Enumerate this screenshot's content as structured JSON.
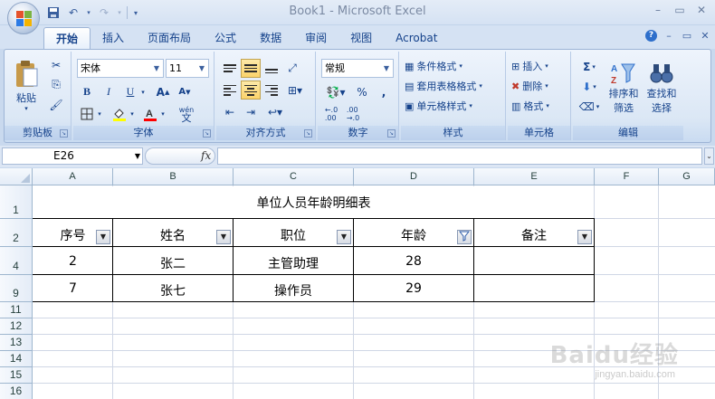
{
  "window": {
    "title": "Book1 - Microsoft Excel",
    "controls": [
      "–",
      "▭",
      "✕"
    ]
  },
  "qat": {
    "save_icon": "save-icon",
    "undo_icon": "undo-icon",
    "redo_icon": "redo-icon"
  },
  "ribbon_tabs": [
    "开始",
    "插入",
    "页面布局",
    "公式",
    "数据",
    "审阅",
    "视图",
    "Acrobat"
  ],
  "ribbon_tab_active": "开始",
  "ribbon_right": [
    "?",
    "–",
    "▭",
    "✕"
  ],
  "clipboard": {
    "paste_label": "粘贴",
    "group_label": "剪贴板"
  },
  "font": {
    "name": "宋体",
    "size": "11",
    "bold": "B",
    "italic": "I",
    "underline": "U",
    "grow": "A",
    "shrink": "A",
    "phonetic": "wén",
    "group_label": "字体",
    "fill_color": "#ffff00",
    "font_color": "#ff0000"
  },
  "alignment": {
    "group_label": "对齐方式"
  },
  "number": {
    "format": "常规",
    "percent": "%",
    "comma": ",",
    "group_label": "数字"
  },
  "styles": {
    "conditional": "条件格式",
    "table_format": "套用表格格式",
    "cell_styles": "单元格样式",
    "group_label": "样式"
  },
  "cells": {
    "insert": "插入",
    "delete": "删除",
    "format": "格式",
    "group_label": "单元格"
  },
  "editing": {
    "sigma": "Σ",
    "sort_filter_1": "排序和",
    "sort_filter_2": "筛选",
    "find_1": "查找和",
    "find_2": "选择",
    "group_label": "编辑"
  },
  "formula_bar": {
    "name_box": "E26",
    "fx": "fx",
    "value": ""
  },
  "columns": [
    "A",
    "B",
    "C",
    "D",
    "E",
    "F",
    "G"
  ],
  "rows": [
    "1",
    "2",
    "4",
    "9",
    "11",
    "12",
    "13",
    "14",
    "15",
    "16"
  ],
  "sheet": {
    "title": "单位人员年龄明细表",
    "headers": [
      "序号",
      "姓名",
      "职位",
      "年龄",
      "备注"
    ],
    "data": [
      [
        "2",
        "张二",
        "主管助理",
        "28",
        ""
      ],
      [
        "7",
        "张七",
        "操作员",
        "29",
        ""
      ]
    ]
  },
  "watermark": {
    "main": "Baidu经验",
    "sub": "jingyan.baidu.com"
  }
}
